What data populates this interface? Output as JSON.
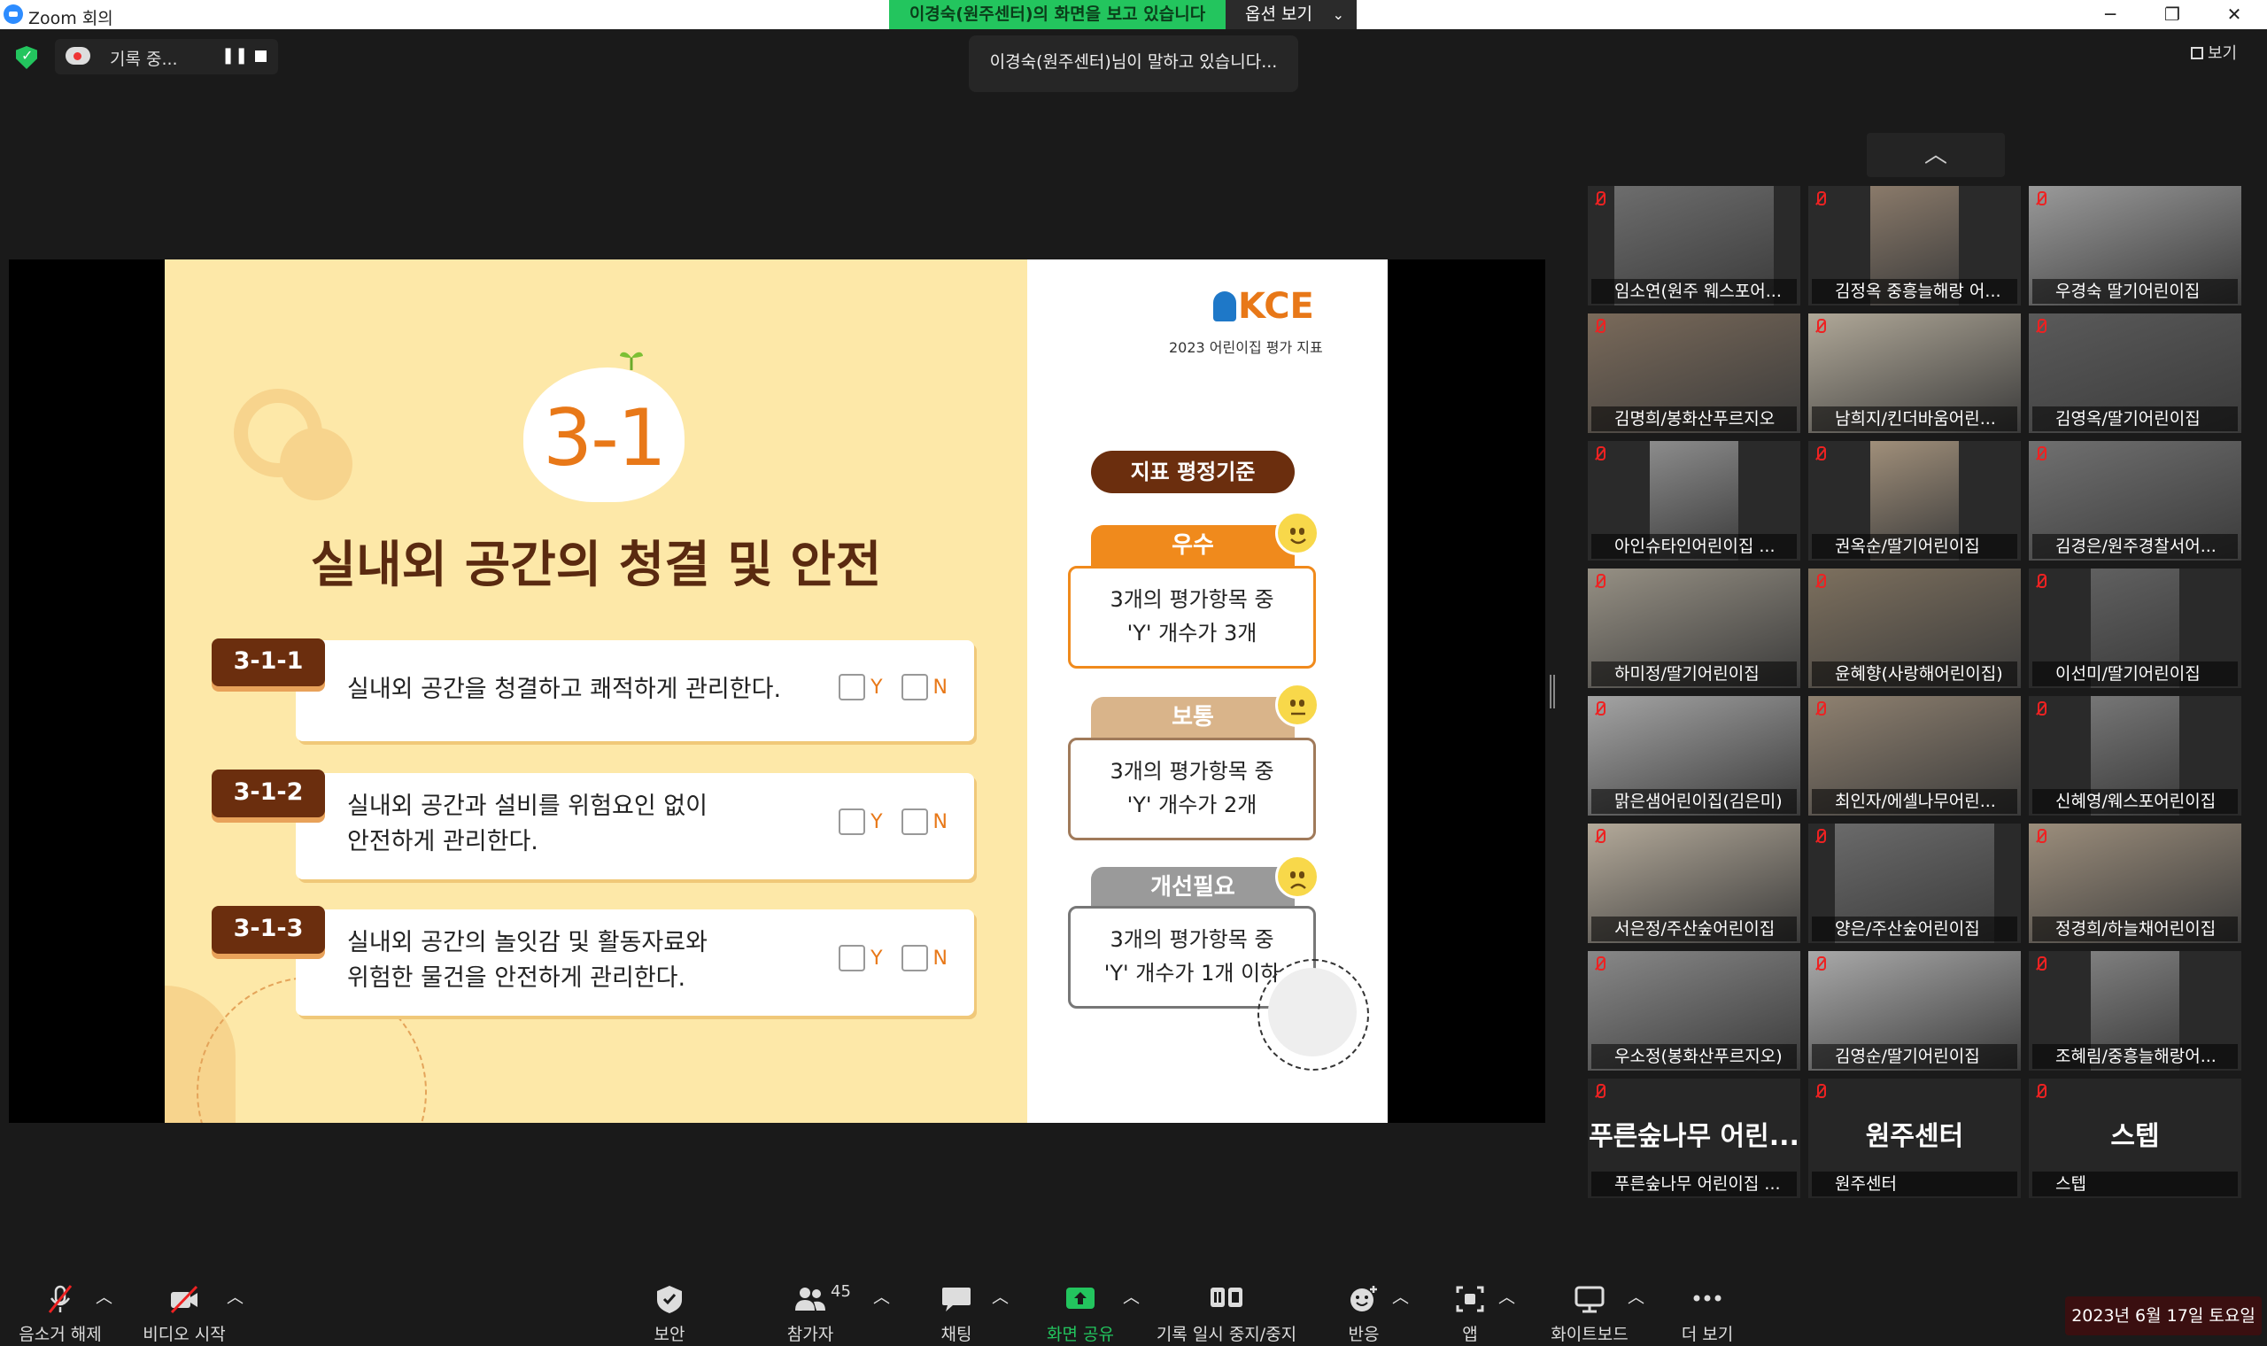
{
  "window": {
    "title": "Zoom 회의"
  },
  "share_banner": {
    "text": "이경숙(원주센터)의 화면을 보고 있습니다",
    "view_options": "옵션 보기"
  },
  "recording": {
    "label": "기록 중..."
  },
  "speaking": "이경숙(원주센터)님이 말하고 있습니다...",
  "view_button": "보기",
  "slide": {
    "section_number": "3-1",
    "title": "실내외 공간의 청결 및 안전",
    "items": [
      {
        "code": "3-1-1",
        "line1": "실내외 공간을 청결하고 쾌적하게 관리한다.",
        "line2": "",
        "y": "Y",
        "n": "N"
      },
      {
        "code": "3-1-2",
        "line1": "실내외 공간과 설비를 위험요인 없이",
        "line2": "안전하게 관리한다.",
        "y": "Y",
        "n": "N"
      },
      {
        "code": "3-1-3",
        "line1": "실내외 공간의 놀잇감 및 활동자료와",
        "line2": "위험한 물건을 안전하게 관리한다.",
        "y": "Y",
        "n": "N"
      }
    ],
    "logo_text": "KCE",
    "logo_sub": "2023 어린이집 평가 지표",
    "criteria_title": "지표 평정기준",
    "grades": [
      {
        "label": "우수",
        "line1": "3개의 평가항목 중",
        "line2": "'Y' 개수가 3개",
        "color": "#f08a1c"
      },
      {
        "label": "보통",
        "line1": "3개의 평가항목 중",
        "line2": "'Y' 개수가 2개",
        "color": "#d9b48a"
      },
      {
        "label": "개선필요",
        "line1": "3개의 평가항목 중",
        "line2": "'Y' 개수가 1개 이하",
        "color": "#9a9a9a"
      }
    ]
  },
  "gallery": {
    "participants": [
      "임소연(원주 웨스포어...",
      "김정옥 중흥늘해랑 어...",
      "우경숙 딸기어린이집",
      "김명희/봉화산푸르지오",
      "남희지/킨더바움어린...",
      "김영옥/딸기어린이집",
      "아인슈타인어린이집 ...",
      "권옥순/딸기어린이집",
      "김경은/원주경찰서어...",
      "하미정/딸기어린이집",
      "윤혜향(사랑해어린이집)",
      "이선미/딸기어린이집",
      "맑은샘어린이집(김은미)",
      "최인자/에셀나무어린...",
      "신혜영/웨스포어린이집",
      "서은정/주산숲어린이집",
      "양은/주산숲어린이집",
      "정경희/하늘채어린이집",
      "우소정(봉화산푸르지오)",
      "김영순/딸기어린이집",
      "조혜림/중흥늘해랑어..."
    ],
    "no_video": [
      {
        "big": "푸른숲나무 어린...",
        "name": "푸른숲나무 어린이집 ..."
      },
      {
        "big": "원주센터",
        "name": "원주센터"
      },
      {
        "big": "스텝",
        "name": "스텝"
      }
    ]
  },
  "toolbar": {
    "unmute": "음소거 해제",
    "start_video": "비디오 시작",
    "security": "보안",
    "participants": "참가자",
    "participants_count": "45",
    "chat": "채팅",
    "share_screen": "화면 공유",
    "pause_record": "기록 일시 중지/중지",
    "reactions": "반응",
    "apps": "앱",
    "whiteboard": "화이트보드",
    "more": "더 보기"
  },
  "date": "2023년 6월 17일 토요일",
  "colors": {
    "share_green": "#23c55e",
    "accent_orange": "#e87818",
    "brown": "#6b2e0e",
    "muted_red": "#e22222"
  }
}
